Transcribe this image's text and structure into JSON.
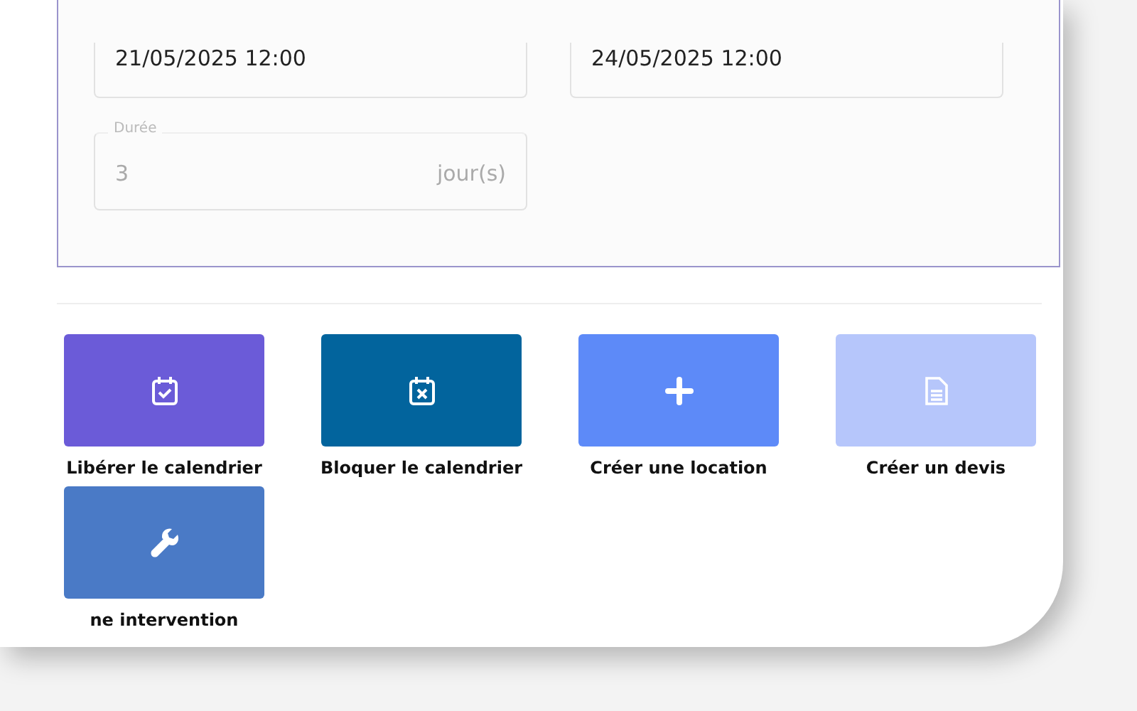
{
  "date_fields": [
    {
      "value": "21/05/2025 12:00"
    },
    {
      "value": "24/05/2025 12:00"
    }
  ],
  "duration": {
    "label": "Durée",
    "value": "3",
    "unit": "jour(s)",
    "disabled": true
  },
  "actions": [
    {
      "label": "Libérer le calendrier",
      "kind": "calendar-check",
      "color": "#6b5bd8"
    },
    {
      "label": "Bloquer le calendrier",
      "kind": "calendar-x",
      "color": "#02649d"
    },
    {
      "label": "Créer une location",
      "kind": "plus",
      "color": "#5d8af8"
    },
    {
      "label": "Créer un devis",
      "kind": "document",
      "color": "#b6c6fb"
    },
    {
      "label": "ne intervention",
      "kind": "wrench",
      "color": "#4a7ac6"
    }
  ]
}
